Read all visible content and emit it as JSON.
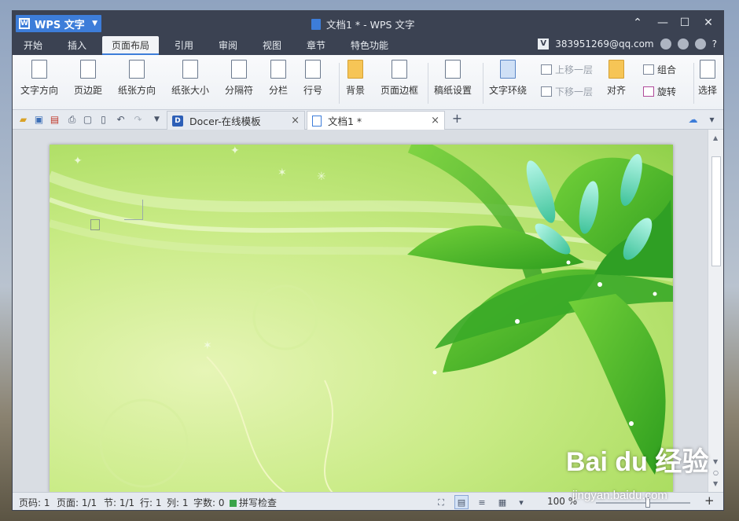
{
  "app": {
    "name": "WPS 文字",
    "window_title": "文档1 * - WPS 文字",
    "window_controls": [
      "⌃",
      "—",
      "☐",
      "✕"
    ]
  },
  "menu": {
    "items": [
      "开始",
      "插入",
      "页面布局",
      "引用",
      "审阅",
      "视图",
      "章节",
      "特色功能"
    ],
    "active": "页面布局",
    "account": "383951269@qq.com",
    "account_badge": "V",
    "help": "?"
  },
  "ribbon": {
    "text_direction": "文字方向",
    "margins": "页边距",
    "orientation": "纸张方向",
    "paper_size": "纸张大小",
    "breaks": "分隔符",
    "columns": "分栏",
    "line_numbers": "行号",
    "background": "背景",
    "page_border": "页面边框",
    "manuscript": "稿纸设置",
    "text_wrap": "文字环绕",
    "bring_forward": "上移一层",
    "send_backward": "下移一层",
    "align": "对齐",
    "group": "组合",
    "rotate": "旋转",
    "select": "选择"
  },
  "tabs": {
    "docer": "Docer-在线模板",
    "doc": "文档1 *",
    "close": "×",
    "add": "+"
  },
  "status": {
    "page_num": "页码: 1",
    "pages": "页面: 1/1",
    "section": "节: 1/1",
    "row": "行: 1",
    "col": "列: 1",
    "words": "字数: 0",
    "spell": "拼写检查",
    "zoom": "100 %",
    "zoom_level": 0.55
  },
  "watermark": {
    "brand": "Bai du 经验",
    "url": "jingyan.baidu.com"
  },
  "colors": {
    "titlebar": "#3b4252",
    "accent": "#3d7dd9",
    "page_green": "#a7db5c"
  }
}
